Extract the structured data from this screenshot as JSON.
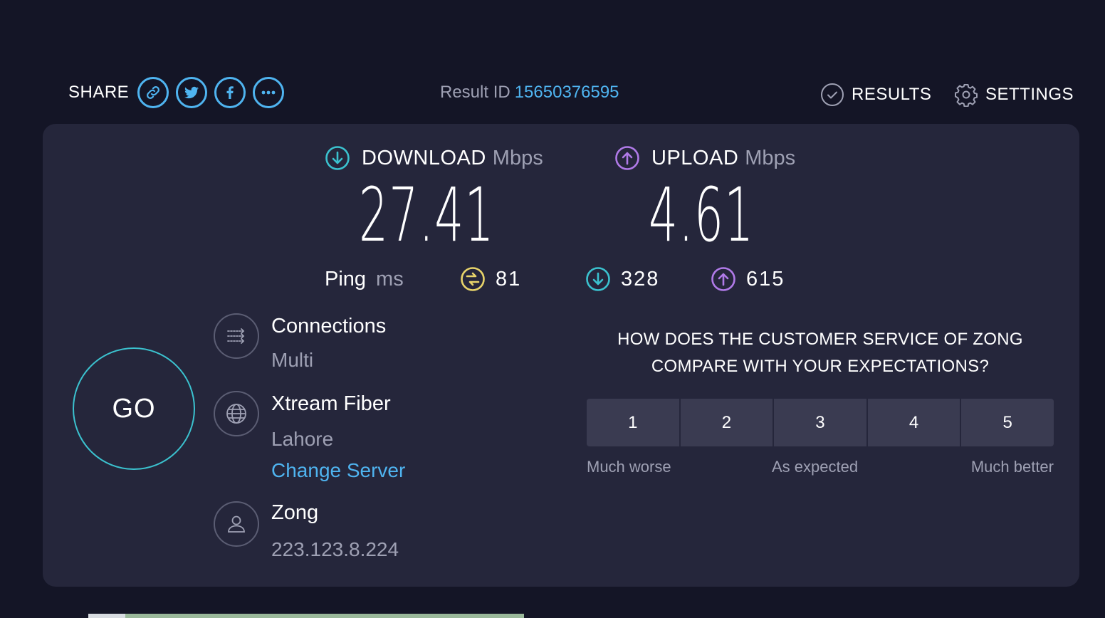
{
  "header": {
    "share_label": "SHARE",
    "share_buttons": [
      "link-icon",
      "twitter-icon",
      "facebook-icon",
      "more-icon"
    ],
    "result_id_label": "Result ID",
    "result_id_value": "15650376595",
    "results_label": "RESULTS",
    "settings_label": "SETTINGS"
  },
  "metrics": {
    "download": {
      "label": "DOWNLOAD",
      "unit": "Mbps",
      "value": "27.41"
    },
    "upload": {
      "label": "UPLOAD",
      "unit": "Mbps",
      "value": "4.61"
    }
  },
  "ping": {
    "label": "Ping",
    "unit": "ms",
    "idle": "81",
    "download": "328",
    "upload": "615"
  },
  "go_label": "GO",
  "connections": {
    "title": "Connections",
    "value": "Multi"
  },
  "server": {
    "name": "Xtream Fiber",
    "location": "Lahore",
    "change_label": "Change Server"
  },
  "provider": {
    "name": "Zong",
    "ip": "223.123.8.224"
  },
  "survey": {
    "question_line1": "HOW DOES THE CUSTOMER SERVICE OF ZONG",
    "question_line2": "COMPARE WITH YOUR EXPECTATIONS?",
    "options": [
      "1",
      "2",
      "3",
      "4",
      "5"
    ],
    "label_left": "Much worse",
    "label_mid": "As expected",
    "label_right": "Much better"
  },
  "colors": {
    "accent_blue": "#4fb4f0",
    "download_cyan": "#3bc2cf",
    "upload_purple": "#b07ae8",
    "ping_yellow": "#e8d46a",
    "background": "#141526",
    "card": "#25263b"
  }
}
